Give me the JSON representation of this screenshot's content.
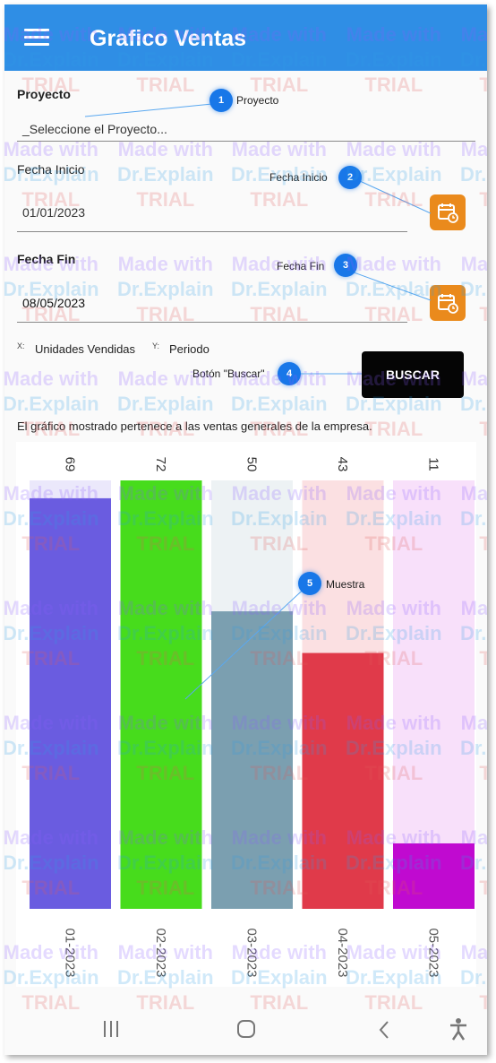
{
  "appbar": {
    "title": "Grafico Ventas",
    "menu_icon": "hamburger-menu-icon"
  },
  "form": {
    "proyecto_label": "Proyecto",
    "proyecto_value": "_Seleccione el Proyecto...",
    "fecha_inicio_label": "Fecha Inicio",
    "fecha_inicio_value": "01/01/2023",
    "fecha_fin_label": "Fecha Fin",
    "fecha_fin_value": "08/05/2023",
    "x_key": "X:",
    "x_value": "Unidades Vendidas",
    "y_key": "Y:",
    "y_value": "Periodo",
    "buscar_label": "BUSCAR",
    "calendar_icon": "calendar-clock-icon",
    "calendar_color": "#ea8a1c"
  },
  "description": "El gráfico mostrado pertenece a las ventas generales de la empresa.",
  "chart_data": {
    "type": "bar",
    "categories": [
      "01-2023",
      "02-2023",
      "03-2023",
      "04-2023",
      "05-2023"
    ],
    "values": [
      69,
      72,
      50,
      43,
      11
    ],
    "colors": [
      "#6a5ce0",
      "#47dc1c",
      "#7b9fb0",
      "#e03a4a",
      "#c00ad0"
    ],
    "bg_colors": [
      "#ebe8fb",
      "#e0f7d7",
      "#edf2f4",
      "#fbe0e2",
      "#f8e0fa"
    ],
    "ylim": [
      0,
      72
    ],
    "value_labels_rotated": true,
    "category_labels_rotated": true
  },
  "callouts": [
    {
      "num": "1",
      "label": "Proyecto"
    },
    {
      "num": "2",
      "label": "Fecha Inicio"
    },
    {
      "num": "3",
      "label": "Fecha Fin"
    },
    {
      "num": "4",
      "label": "Botón \"Buscar\""
    },
    {
      "num": "5",
      "label": "Muestra"
    }
  ],
  "watermark": {
    "line1": "Made with",
    "line2": "Dr.Explain",
    "line3": "TRIAL"
  },
  "navbar": {
    "recent_icon": "recent-apps-icon",
    "home_icon": "home-icon",
    "back_icon": "back-icon",
    "accessibility_icon": "accessibility-icon"
  }
}
